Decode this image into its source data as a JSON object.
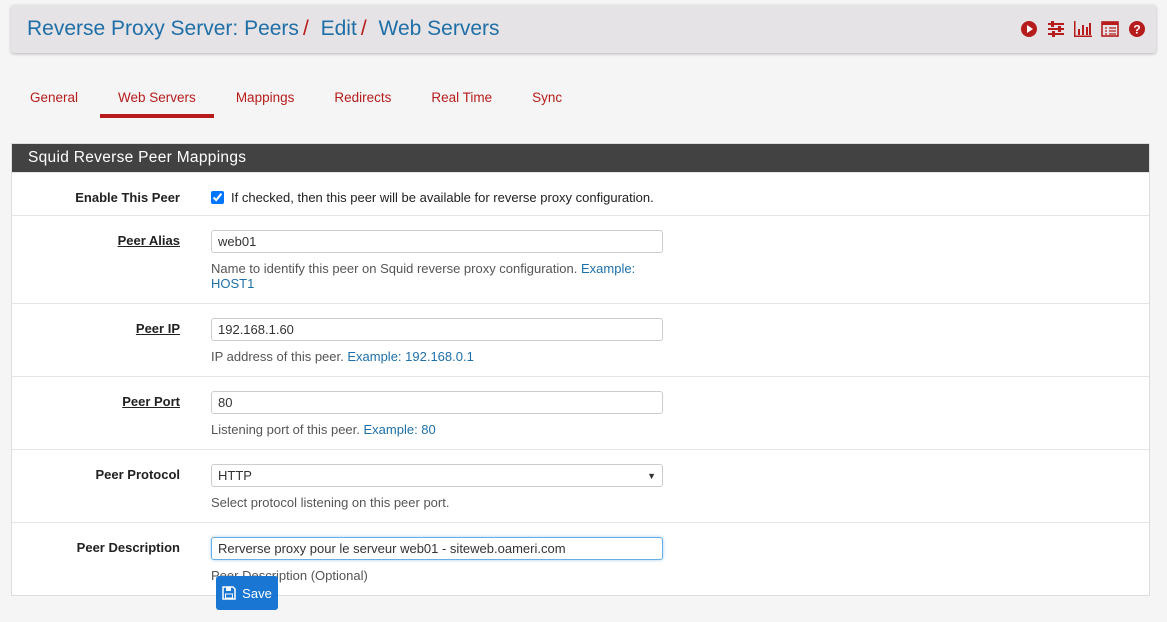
{
  "header": {
    "breadcrumb": [
      "Reverse Proxy Server: Peers",
      "Edit",
      "Web Servers"
    ],
    "separator": "/",
    "icons": [
      "play-circle-icon",
      "sliders-icon",
      "bar-chart-icon",
      "list-alt-icon",
      "question-circle-icon"
    ]
  },
  "tabs": [
    {
      "label": "General"
    },
    {
      "label": "Web Servers",
      "active": true
    },
    {
      "label": "Mappings"
    },
    {
      "label": "Redirects"
    },
    {
      "label": "Real Time"
    },
    {
      "label": "Sync"
    }
  ],
  "panel": {
    "title": "Squid Reverse Peer Mappings",
    "enable": {
      "label": "Enable This Peer",
      "checked": true,
      "text": "If checked, then this peer will be available for reverse proxy configuration."
    },
    "alias": {
      "label": "Peer Alias",
      "value": "web01",
      "help": "Name to identify this peer on Squid reverse proxy configuration. ",
      "example": "Example: HOST1"
    },
    "ip": {
      "label": "Peer IP",
      "value": "192.168.1.60",
      "help": "IP address of this peer. ",
      "example": "Example: 192.168.0.1"
    },
    "port": {
      "label": "Peer Port",
      "value": "80",
      "help": "Listening port of this peer. ",
      "example": "Example: 80"
    },
    "protocol": {
      "label": "Peer Protocol",
      "value": "HTTP",
      "help": "Select protocol listening on this peer port."
    },
    "description": {
      "label": "Peer Description",
      "value": "Rerverse proxy pour le serveur web01 - siteweb.oameri.com",
      "help": "Peer Description (Optional)"
    }
  },
  "save": {
    "label": "Save"
  },
  "colors": {
    "accent": "#b71c1c",
    "link": "#1e6fa7",
    "button": "#1976d2"
  }
}
